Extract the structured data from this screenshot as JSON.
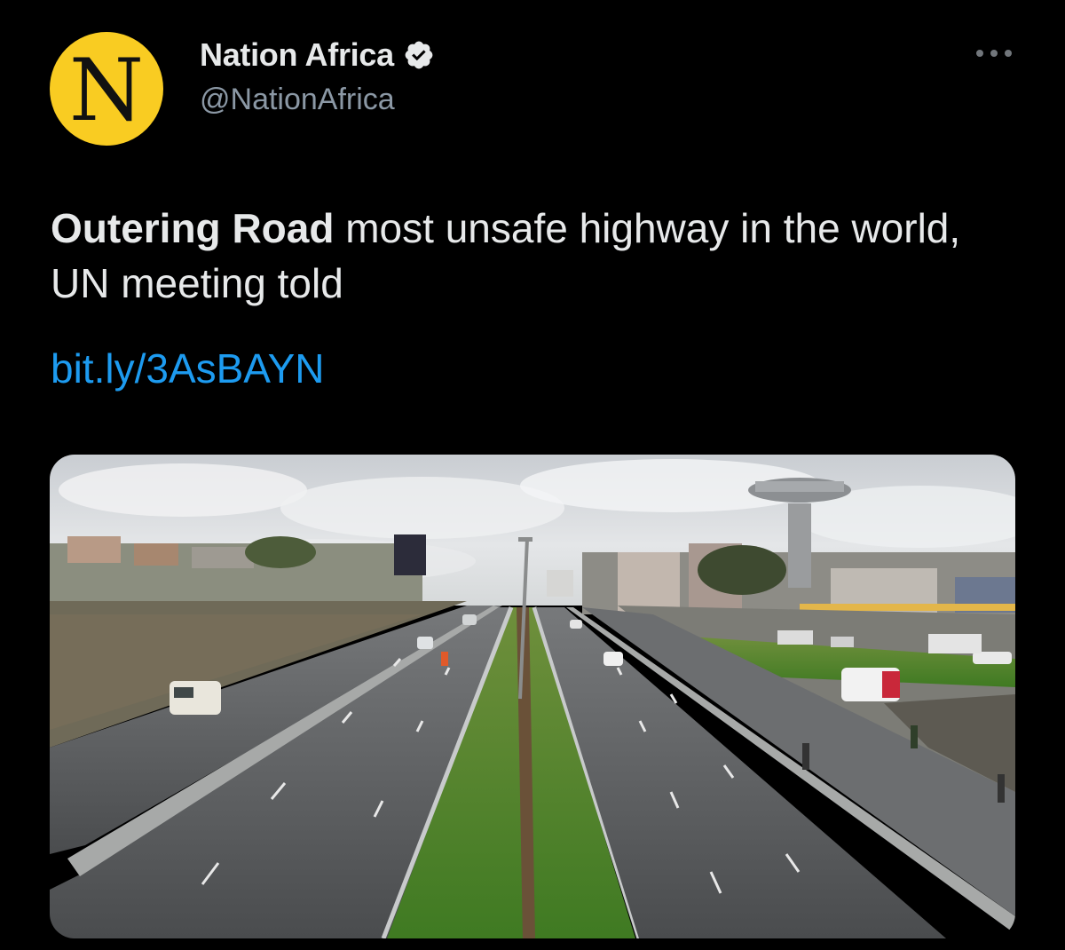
{
  "account": {
    "avatar_letter": "N",
    "avatar_color": "#f9cc22",
    "display_name": "Nation Africa",
    "verified": true,
    "handle": "@NationAfrica"
  },
  "tweet": {
    "headline_bold": "Outering Road",
    "headline_rest": " most unsafe highway in the world, UN meeting told",
    "link": "bit.ly/3AsBAYN"
  },
  "media": {
    "description": "Aerial-view photo of a divided multi-lane highway with a grassy median, a water tower, buildings and vehicles"
  },
  "icons": {
    "verified": "verified-badge-icon",
    "more": "more-options-icon"
  },
  "colors": {
    "background": "#000000",
    "text": "#e7e9ea",
    "secondary_text": "#8b98a5",
    "link": "#1d9bf0"
  }
}
